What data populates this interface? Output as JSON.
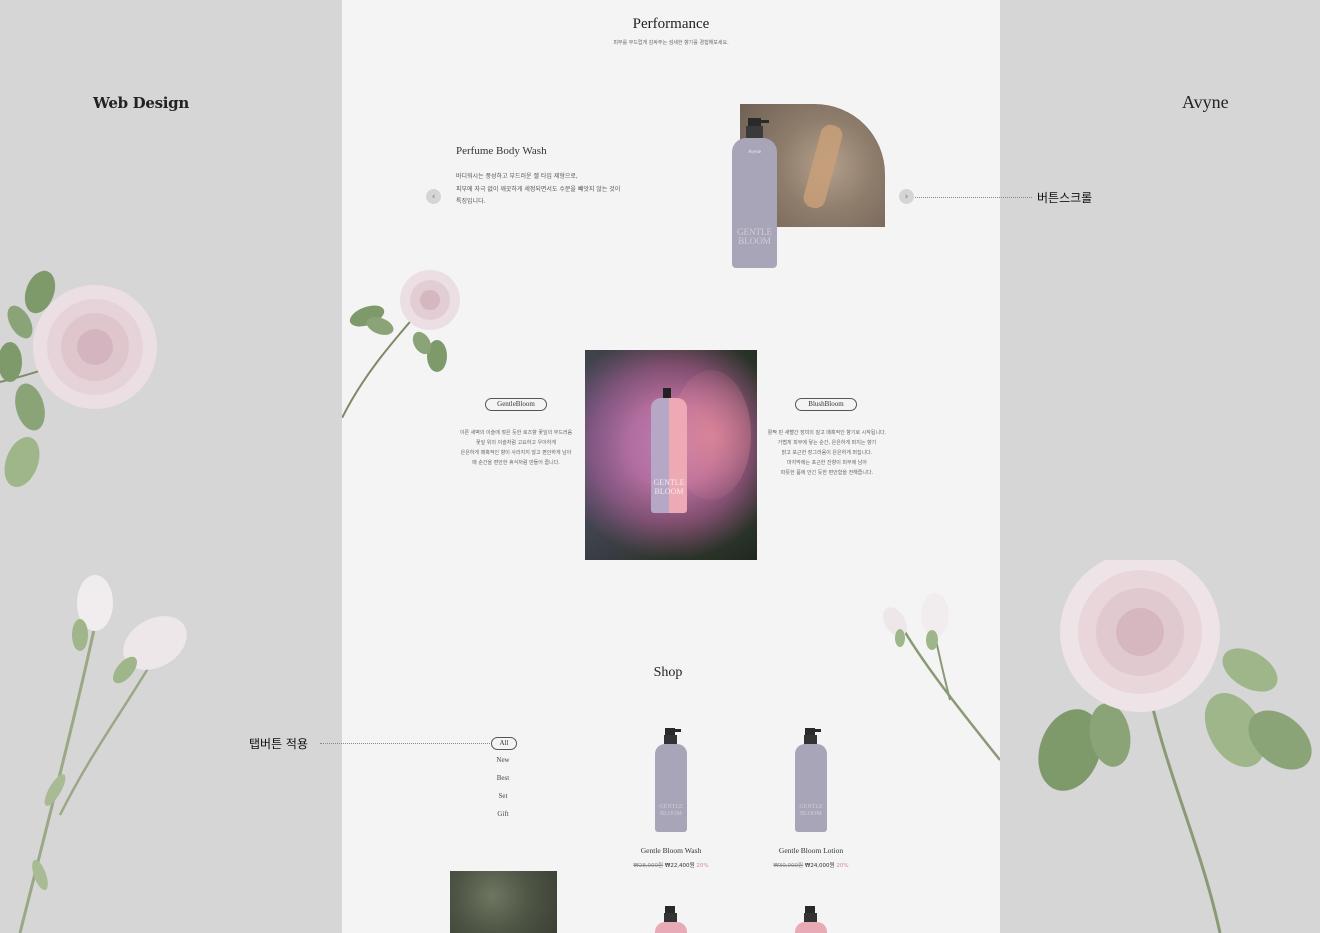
{
  "side": {
    "left_title": "Web Design",
    "right_title": "Avyne"
  },
  "annotations": {
    "scroll_button": "버튼스크롤",
    "tab_button": "탭버튼 적용"
  },
  "performance": {
    "title": "Performance",
    "subtitle": "피부를 부드럽게 감싸주는 섬세한 향기를 경험해보세요.",
    "product_title": "Perfume Body Wash",
    "desc": [
      "바디워시는 풍성하고 부드러운 젤 타입 제형으로,",
      "피부에 자극 없이 깨끗하게 세정되면서도 수분을 빼앗지 않는 것이",
      "특징입니다."
    ],
    "prev_icon": "chevron-left-icon",
    "next_icon": "chevron-right-icon"
  },
  "bottle_label": {
    "brand": "Avyne",
    "name_line1": "GENTLE",
    "name_line2": "BLOOM"
  },
  "variants": {
    "left_tag": "GentleBloom",
    "left_desc": [
      "이른 새벽의 이슬에 젖은 듯한 로즈향 꽃잎의 부드러움",
      "꽃잎 위의 이슬처럼 고요하고 우아하게",
      "은은하게 매혹적인 향이 사라지지 않고 편안하게 남아",
      "매 순간을 편안한 휴식처럼 만들어 줍니다."
    ],
    "right_tag": "BlushBloom",
    "right_desc": [
      "활짝 핀 새빨간 장미의 짙고 매혹적인 향기로 시작됩니다.",
      "가볍게 피부에 닿는 순간, 은은하게 퍼지는 향기",
      "맑고 포근한 장그러움이 은은하게 퍼집니다.",
      "마지막에는 포근한 잔향이 피부에 남아",
      "따뜻한 품에 안긴 듯한 편안함을 전해줍니다."
    ]
  },
  "shop": {
    "title": "Shop",
    "tabs": [
      "All",
      "New",
      "Best",
      "Set",
      "Gift"
    ],
    "products": [
      {
        "name": "Gentle Bloom Wash",
        "old_price": "₩28,000원",
        "price": "₩22,400원",
        "discount": "20%"
      },
      {
        "name": "Gentle Bloom Lotion",
        "old_price": "₩30,000원",
        "price": "₩24,000원",
        "discount": "20%"
      }
    ]
  },
  "colors": {
    "page_bg": "#f4f4f4",
    "side_bg": "#d6d6d6",
    "bottle": "#a9a5b8",
    "pink_bottle": "#e8aab5",
    "accent_pink": "#d28aa0"
  }
}
